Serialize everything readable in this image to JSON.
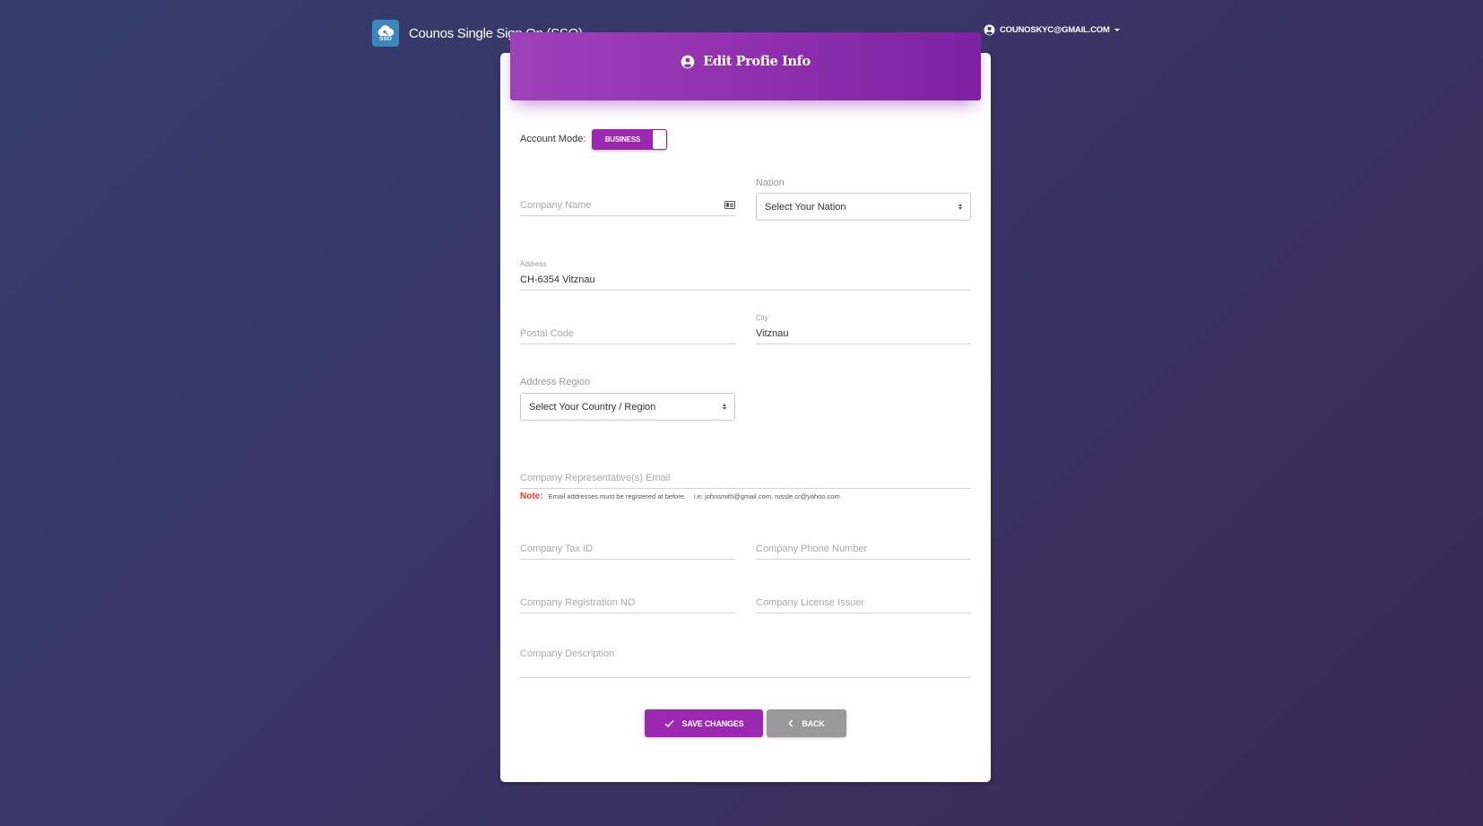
{
  "navbar": {
    "brand_logo_text": "SSO",
    "brand_title": "Counos Single Sign On (SSO)",
    "user_email": "COUNOSKYC@GMAIL.COM",
    "user_icon": "account-circle-icon"
  },
  "card": {
    "title": "Edit Profie Info",
    "title_icon": "account-circle-icon"
  },
  "form": {
    "account_mode": {
      "label": "Account Mode:",
      "value": "BUSINESS"
    },
    "company_name": {
      "placeholder": "Company Name",
      "value": "",
      "icon": "id-card-icon"
    },
    "nation": {
      "label": "Nation",
      "selected": "Select Your Nation"
    },
    "address": {
      "label": "Address",
      "value": "CH-6354 Vitznau"
    },
    "postal_code": {
      "placeholder": "Postal Code",
      "value": ""
    },
    "city": {
      "label": "City",
      "value": "Vitznau"
    },
    "address_region": {
      "label": "Address Region",
      "selected": "Select Your Country / Region"
    },
    "representative_email": {
      "placeholder": "Company Representative(s) Email",
      "value": ""
    },
    "note": {
      "label": "Note:",
      "text": "Email addresses must be registered at before.",
      "example": "i.e: johnsmith@gmail.com, russle.cr@yahoo.com"
    },
    "tax_id": {
      "placeholder": "Company Tax ID",
      "value": ""
    },
    "phone_number": {
      "placeholder": "Company Phone Number",
      "value": ""
    },
    "registration_no": {
      "placeholder": "Company Registration NO",
      "value": ""
    },
    "license_issuer": {
      "placeholder": "Company License Issuer",
      "value": ""
    },
    "description": {
      "placeholder": "Company Description",
      "value": ""
    }
  },
  "actions": {
    "save_label": "SAVE CHANGES",
    "back_label": "BACK"
  },
  "colors": {
    "accent": "#9c27b0",
    "header_gradient_start": "#a040b8",
    "header_gradient_end": "#7c22a2",
    "back_button": "#999999",
    "note_label": "#e53935",
    "background_start": "#343d6e",
    "background_end": "#3b2a55"
  }
}
